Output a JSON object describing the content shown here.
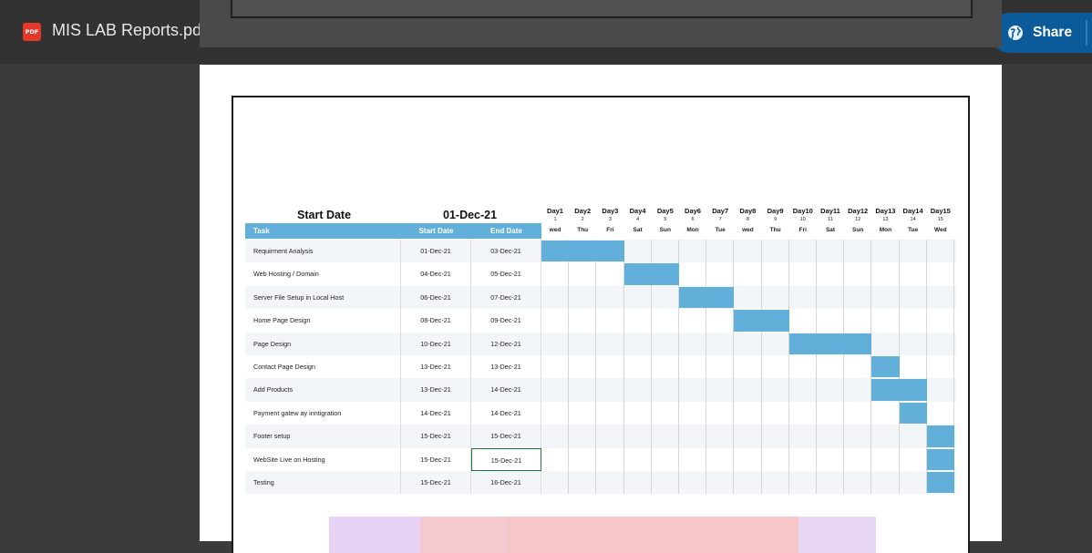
{
  "toolbar": {
    "file_badge": "PDF",
    "title": "MIS LAB Reports.pdf",
    "icons": [
      "add-to-drive-icon",
      "print-icon",
      "more-vert-icon"
    ],
    "share_label": "Share"
  },
  "sheet": {
    "start_date_label": "Start Date",
    "start_date_value": "01-Dec-21",
    "columns": {
      "task": "Task",
      "start": "Start Date",
      "end": "End Date"
    },
    "days": [
      {
        "label": "Day1",
        "num": "1",
        "wk": "wed"
      },
      {
        "label": "Day2",
        "num": "2",
        "wk": "Thu"
      },
      {
        "label": "Day3",
        "num": "3",
        "wk": "Fri"
      },
      {
        "label": "Day4",
        "num": "4",
        "wk": "Sat"
      },
      {
        "label": "Day5",
        "num": "5",
        "wk": "Sun"
      },
      {
        "label": "Day6",
        "num": "6",
        "wk": "Mon"
      },
      {
        "label": "Day7",
        "num": "7",
        "wk": "Tue"
      },
      {
        "label": "Day8",
        "num": "8",
        "wk": "wed"
      },
      {
        "label": "Day9",
        "num": "9",
        "wk": "Thu"
      },
      {
        "label": "Day10",
        "num": "10",
        "wk": "Fri"
      },
      {
        "label": "Day11",
        "num": "11",
        "wk": "Sat"
      },
      {
        "label": "Day12",
        "num": "12",
        "wk": "Sun"
      },
      {
        "label": "Day13",
        "num": "13",
        "wk": "Mon"
      },
      {
        "label": "Day14",
        "num": "14",
        "wk": "Tue"
      },
      {
        "label": "Day15",
        "num": "15",
        "wk": "Wed"
      }
    ],
    "tasks": [
      {
        "task": "Requirment Analysis",
        "start": "01-Dec-21",
        "end": "03-Dec-21",
        "from": 1,
        "to": 3
      },
      {
        "task": "Web Hosting / Domain",
        "start": "04-Dec-21",
        "end": "05-Dec-21",
        "from": 4,
        "to": 5
      },
      {
        "task": "Server File Setup in Local Host",
        "start": "06-Dec-21",
        "end": "07-Dec-21",
        "from": 6,
        "to": 7
      },
      {
        "task": "Home Page Design",
        "start": "08-Dec-21",
        "end": "09-Dec-21",
        "from": 8,
        "to": 9
      },
      {
        "task": "Page Design",
        "start": "10-Dec-21",
        "end": "12-Dec-21",
        "from": 10,
        "to": 12
      },
      {
        "task": "Contact Page Design",
        "start": "13-Dec-21",
        "end": "13-Dec-21",
        "from": 13,
        "to": 13
      },
      {
        "task": "Add Products",
        "start": "13-Dec-21",
        "end": "14-Dec-21",
        "from": 13,
        "to": 14
      },
      {
        "task": "Payment gatew ay inntigration",
        "start": "14-Dec-21",
        "end": "14-Dec-21",
        "from": 14,
        "to": 14
      },
      {
        "task": "Footer setup",
        "start": "15-Dec-21",
        "end": "15-Dec-21",
        "from": 15,
        "to": 15
      },
      {
        "task": "WebSite Live  on Hosting",
        "start": "15-Dec-21",
        "end": "15-Dec-21",
        "from": 15,
        "to": 15
      },
      {
        "task": "Testing",
        "start": "15-Dec-21",
        "end": "16-Dec-21",
        "from": 15,
        "to": 15
      }
    ]
  },
  "colors": {
    "bar": "#62afd9",
    "topbar": "#323232",
    "viewer_bg": "#3b3b3b",
    "share": "#0b5a99",
    "selected_cell_border": "#217346"
  }
}
